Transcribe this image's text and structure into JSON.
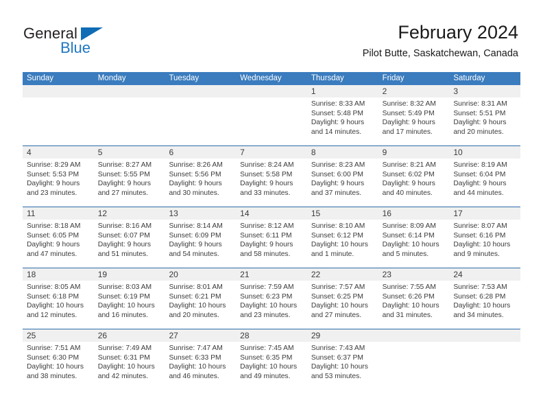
{
  "brand": {
    "name_part1": "General",
    "name_part2": "Blue",
    "accent_color": "#0f6cb5"
  },
  "header": {
    "title": "February 2024",
    "location": "Pilot Butte, Saskatchewan, Canada"
  },
  "calendar": {
    "header_bg": "#3a7cbe",
    "row_border_color": "#2b6ca8",
    "daynum_bg": "#f0f0f0",
    "weekdays": [
      "Sunday",
      "Monday",
      "Tuesday",
      "Wednesday",
      "Thursday",
      "Friday",
      "Saturday"
    ],
    "weeks": [
      [
        {
          "empty": true
        },
        {
          "empty": true
        },
        {
          "empty": true
        },
        {
          "empty": true
        },
        {
          "day": "1",
          "sunrise": "Sunrise: 8:33 AM",
          "sunset": "Sunset: 5:48 PM",
          "daylight": "Daylight: 9 hours and 14 minutes."
        },
        {
          "day": "2",
          "sunrise": "Sunrise: 8:32 AM",
          "sunset": "Sunset: 5:49 PM",
          "daylight": "Daylight: 9 hours and 17 minutes."
        },
        {
          "day": "3",
          "sunrise": "Sunrise: 8:31 AM",
          "sunset": "Sunset: 5:51 PM",
          "daylight": "Daylight: 9 hours and 20 minutes."
        }
      ],
      [
        {
          "day": "4",
          "sunrise": "Sunrise: 8:29 AM",
          "sunset": "Sunset: 5:53 PM",
          "daylight": "Daylight: 9 hours and 23 minutes."
        },
        {
          "day": "5",
          "sunrise": "Sunrise: 8:27 AM",
          "sunset": "Sunset: 5:55 PM",
          "daylight": "Daylight: 9 hours and 27 minutes."
        },
        {
          "day": "6",
          "sunrise": "Sunrise: 8:26 AM",
          "sunset": "Sunset: 5:56 PM",
          "daylight": "Daylight: 9 hours and 30 minutes."
        },
        {
          "day": "7",
          "sunrise": "Sunrise: 8:24 AM",
          "sunset": "Sunset: 5:58 PM",
          "daylight": "Daylight: 9 hours and 33 minutes."
        },
        {
          "day": "8",
          "sunrise": "Sunrise: 8:23 AM",
          "sunset": "Sunset: 6:00 PM",
          "daylight": "Daylight: 9 hours and 37 minutes."
        },
        {
          "day": "9",
          "sunrise": "Sunrise: 8:21 AM",
          "sunset": "Sunset: 6:02 PM",
          "daylight": "Daylight: 9 hours and 40 minutes."
        },
        {
          "day": "10",
          "sunrise": "Sunrise: 8:19 AM",
          "sunset": "Sunset: 6:04 PM",
          "daylight": "Daylight: 9 hours and 44 minutes."
        }
      ],
      [
        {
          "day": "11",
          "sunrise": "Sunrise: 8:18 AM",
          "sunset": "Sunset: 6:05 PM",
          "daylight": "Daylight: 9 hours and 47 minutes."
        },
        {
          "day": "12",
          "sunrise": "Sunrise: 8:16 AM",
          "sunset": "Sunset: 6:07 PM",
          "daylight": "Daylight: 9 hours and 51 minutes."
        },
        {
          "day": "13",
          "sunrise": "Sunrise: 8:14 AM",
          "sunset": "Sunset: 6:09 PM",
          "daylight": "Daylight: 9 hours and 54 minutes."
        },
        {
          "day": "14",
          "sunrise": "Sunrise: 8:12 AM",
          "sunset": "Sunset: 6:11 PM",
          "daylight": "Daylight: 9 hours and 58 minutes."
        },
        {
          "day": "15",
          "sunrise": "Sunrise: 8:10 AM",
          "sunset": "Sunset: 6:12 PM",
          "daylight": "Daylight: 10 hours and 1 minute."
        },
        {
          "day": "16",
          "sunrise": "Sunrise: 8:09 AM",
          "sunset": "Sunset: 6:14 PM",
          "daylight": "Daylight: 10 hours and 5 minutes."
        },
        {
          "day": "17",
          "sunrise": "Sunrise: 8:07 AM",
          "sunset": "Sunset: 6:16 PM",
          "daylight": "Daylight: 10 hours and 9 minutes."
        }
      ],
      [
        {
          "day": "18",
          "sunrise": "Sunrise: 8:05 AM",
          "sunset": "Sunset: 6:18 PM",
          "daylight": "Daylight: 10 hours and 12 minutes."
        },
        {
          "day": "19",
          "sunrise": "Sunrise: 8:03 AM",
          "sunset": "Sunset: 6:19 PM",
          "daylight": "Daylight: 10 hours and 16 minutes."
        },
        {
          "day": "20",
          "sunrise": "Sunrise: 8:01 AM",
          "sunset": "Sunset: 6:21 PM",
          "daylight": "Daylight: 10 hours and 20 minutes."
        },
        {
          "day": "21",
          "sunrise": "Sunrise: 7:59 AM",
          "sunset": "Sunset: 6:23 PM",
          "daylight": "Daylight: 10 hours and 23 minutes."
        },
        {
          "day": "22",
          "sunrise": "Sunrise: 7:57 AM",
          "sunset": "Sunset: 6:25 PM",
          "daylight": "Daylight: 10 hours and 27 minutes."
        },
        {
          "day": "23",
          "sunrise": "Sunrise: 7:55 AM",
          "sunset": "Sunset: 6:26 PM",
          "daylight": "Daylight: 10 hours and 31 minutes."
        },
        {
          "day": "24",
          "sunrise": "Sunrise: 7:53 AM",
          "sunset": "Sunset: 6:28 PM",
          "daylight": "Daylight: 10 hours and 34 minutes."
        }
      ],
      [
        {
          "day": "25",
          "sunrise": "Sunrise: 7:51 AM",
          "sunset": "Sunset: 6:30 PM",
          "daylight": "Daylight: 10 hours and 38 minutes."
        },
        {
          "day": "26",
          "sunrise": "Sunrise: 7:49 AM",
          "sunset": "Sunset: 6:31 PM",
          "daylight": "Daylight: 10 hours and 42 minutes."
        },
        {
          "day": "27",
          "sunrise": "Sunrise: 7:47 AM",
          "sunset": "Sunset: 6:33 PM",
          "daylight": "Daylight: 10 hours and 46 minutes."
        },
        {
          "day": "28",
          "sunrise": "Sunrise: 7:45 AM",
          "sunset": "Sunset: 6:35 PM",
          "daylight": "Daylight: 10 hours and 49 minutes."
        },
        {
          "day": "29",
          "sunrise": "Sunrise: 7:43 AM",
          "sunset": "Sunset: 6:37 PM",
          "daylight": "Daylight: 10 hours and 53 minutes."
        },
        {
          "empty": true
        },
        {
          "empty": true
        }
      ]
    ]
  }
}
